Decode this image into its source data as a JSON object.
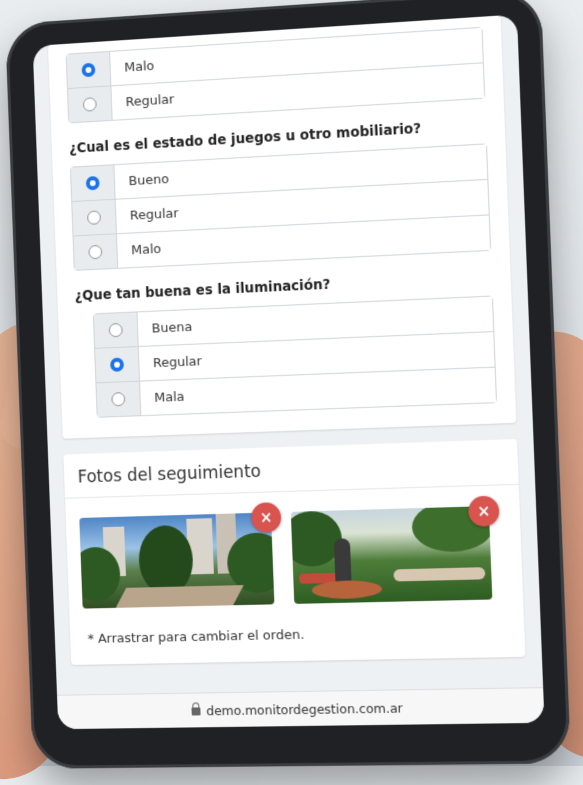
{
  "survey": {
    "q0": {
      "options": [
        {
          "label": "Malo",
          "checked": true
        },
        {
          "label": "Regular",
          "checked": false
        }
      ]
    },
    "q1": {
      "question": "¿Cual es el estado de juegos u otro mobiliario?",
      "options": [
        {
          "label": "Bueno",
          "checked": true
        },
        {
          "label": "Regular",
          "checked": false
        },
        {
          "label": "Malo",
          "checked": false
        }
      ]
    },
    "q2": {
      "question": "¿Que tan buena es la iluminación?",
      "options": [
        {
          "label": "Buena",
          "checked": false
        },
        {
          "label": "Regular",
          "checked": true
        },
        {
          "label": "Mala",
          "checked": false
        }
      ]
    }
  },
  "photos": {
    "title": "Fotos del seguimiento",
    "remove_symbol": "×",
    "hint": "* Arrastrar para cambiar el orden."
  },
  "browser": {
    "url": "demo.monitordegestion.com.ar"
  },
  "colors": {
    "radio_checked": "#1a73e8",
    "remove_button": "#d9534f"
  }
}
